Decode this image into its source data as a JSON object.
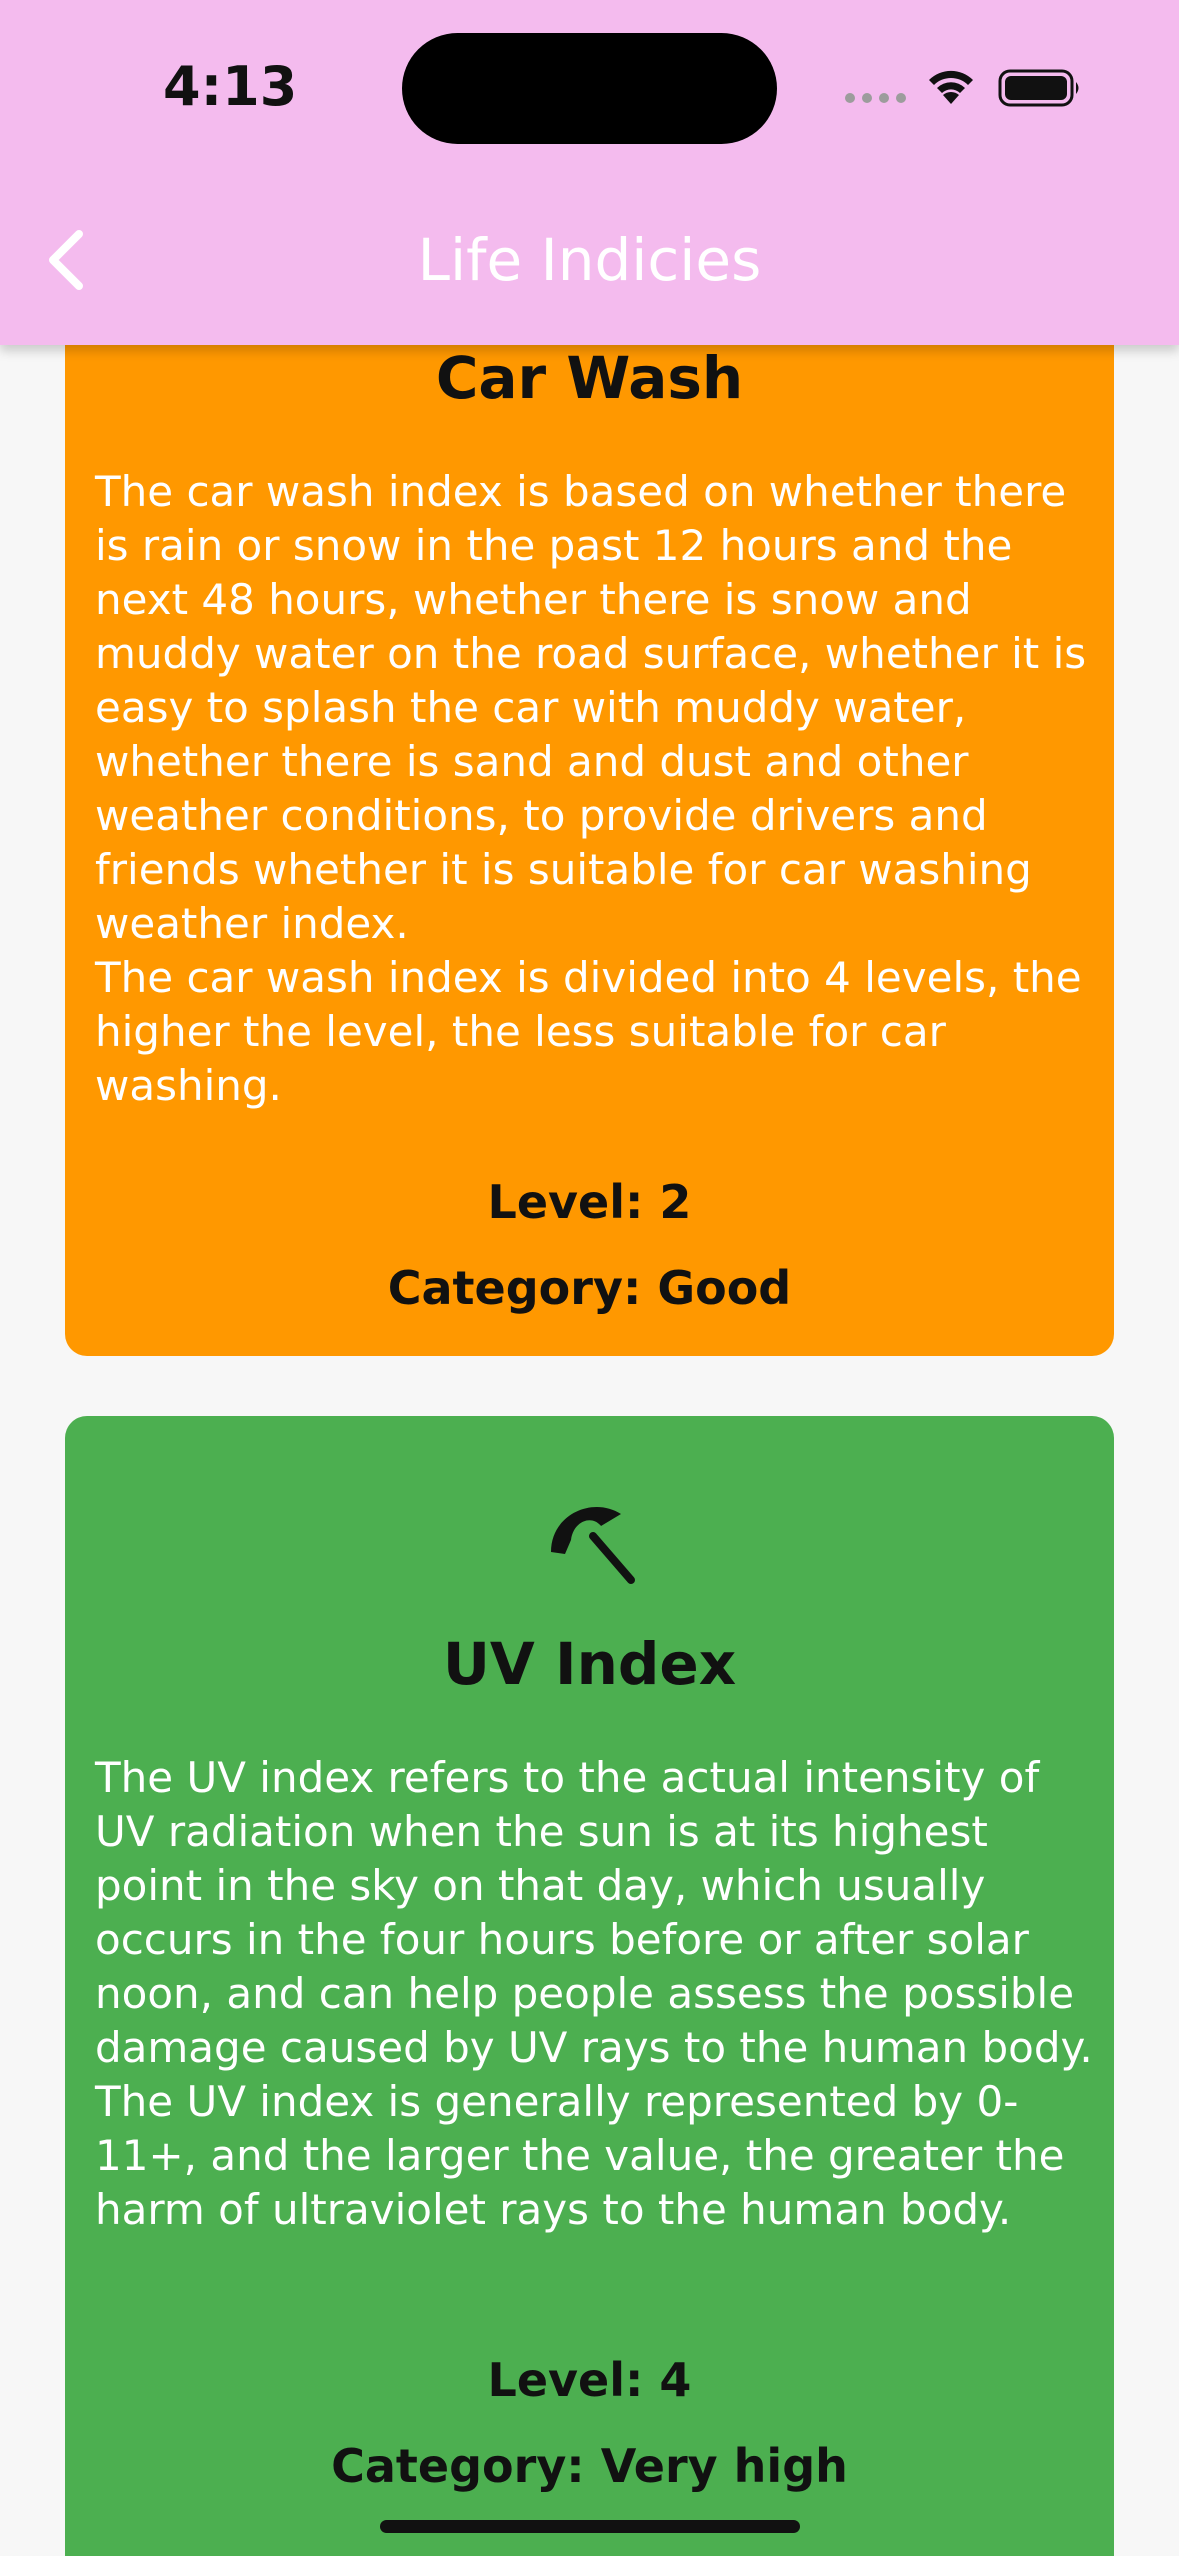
{
  "status_bar": {
    "time": "4:13",
    "wifi_icon": "wifi-icon",
    "battery_icon": "battery-icon"
  },
  "app_bar": {
    "title": "Life Indicies",
    "back_icon": "chevron-left-icon",
    "background": "#f4bbee"
  },
  "cards": [
    {
      "title": "Car Wash",
      "description": "The car wash index is based on whether there is rain or snow in the past 12 hours and the next 48 hours, whether there is snow and muddy water on the road surface, whether it is easy to splash the car with muddy water, whether there is sand and dust and other weather conditions, to provide drivers and friends whether it is suitable for car washing weather index.\nThe car wash index is divided into 4 levels, the higher the level, the less suitable for car washing.",
      "level": "Level: 2",
      "category": "Category: Good",
      "color": "#ff9800"
    },
    {
      "icon": "beach-umbrella-icon",
      "title": "UV Index",
      "description": "The UV index refers to the actual intensity of UV radiation when the sun is at its highest point in the sky on that day, which usually occurs in the four hours before or after solar noon, and can help people assess the possible damage caused by UV rays to the human body.\nThe UV index is generally represented by 0-11+, and the larger the value, the greater the harm of ultraviolet rays to the human body.",
      "level": "Level: 4",
      "category": "Category: Very high",
      "color": "#4caf50"
    }
  ]
}
